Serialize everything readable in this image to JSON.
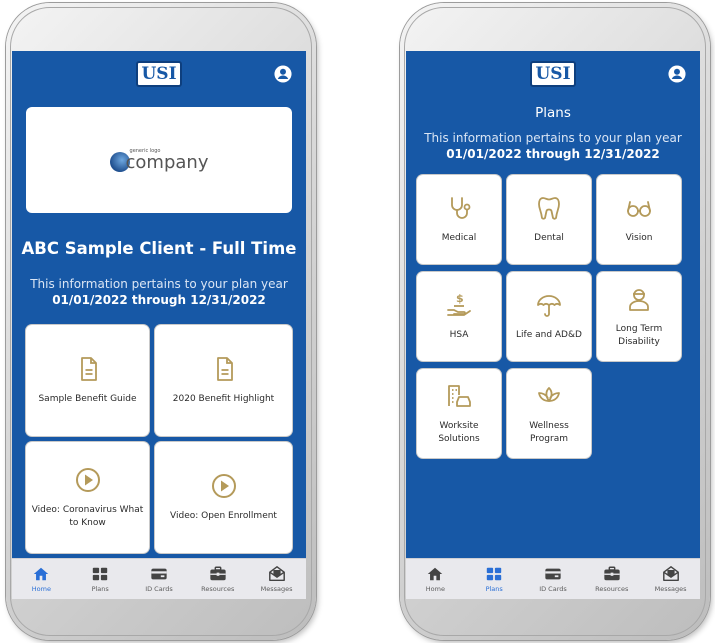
{
  "left_screen": {
    "logo_text": "USI",
    "company_logo": {
      "small_text": "generic logo",
      "name": "company"
    },
    "client_name": "ABC Sample Client - Full Time",
    "plan_info": "This information pertains to your plan year",
    "plan_dates": "01/01/2022 through 12/31/2022",
    "tiles": [
      {
        "label": "Sample Benefit Guide",
        "icon": "document-icon"
      },
      {
        "label": "2020 Benefit Highlight",
        "icon": "document-icon"
      },
      {
        "label": "Video: Coronavirus  What to Know",
        "icon": "play-icon"
      },
      {
        "label": "Video: Open Enrollment",
        "icon": "play-icon"
      }
    ],
    "nav": [
      {
        "label": "Home",
        "icon": "home-icon",
        "active": true
      },
      {
        "label": "Plans",
        "icon": "grid-icon",
        "active": false
      },
      {
        "label": "ID Cards",
        "icon": "card-icon",
        "active": false
      },
      {
        "label": "Resources",
        "icon": "briefcase-icon",
        "active": false
      },
      {
        "label": "Messages",
        "icon": "envelope-icon",
        "active": false
      }
    ]
  },
  "right_screen": {
    "logo_text": "USI",
    "page_title": "Plans",
    "plan_info": "This information pertains to your plan year",
    "plan_dates": "01/01/2022 through 12/31/2022",
    "tiles": [
      {
        "label": "Medical",
        "icon": "stethoscope-icon"
      },
      {
        "label": "Dental",
        "icon": "tooth-icon"
      },
      {
        "label": "Vision",
        "icon": "glasses-icon"
      },
      {
        "label": "HSA",
        "icon": "money-hand-icon"
      },
      {
        "label": "Life and AD&D",
        "icon": "umbrella-icon"
      },
      {
        "label": "Long Term Disability",
        "icon": "worker-icon"
      },
      {
        "label": "Worksite Solutions",
        "icon": "building-car-icon"
      },
      {
        "label": "Wellness Program",
        "icon": "lotus-icon"
      }
    ],
    "nav": [
      {
        "label": "Home",
        "icon": "home-icon",
        "active": false
      },
      {
        "label": "Plans",
        "icon": "grid-icon",
        "active": true
      },
      {
        "label": "ID Cards",
        "icon": "card-icon",
        "active": false
      },
      {
        "label": "Resources",
        "icon": "briefcase-icon",
        "active": false
      },
      {
        "label": "Messages",
        "icon": "envelope-icon",
        "active": false
      }
    ]
  },
  "colors": {
    "brand_blue": "#1758a6",
    "icon_gold": "#b49a5a",
    "nav_active": "#2a6fd6",
    "nav_inactive": "#4a4a4a"
  }
}
